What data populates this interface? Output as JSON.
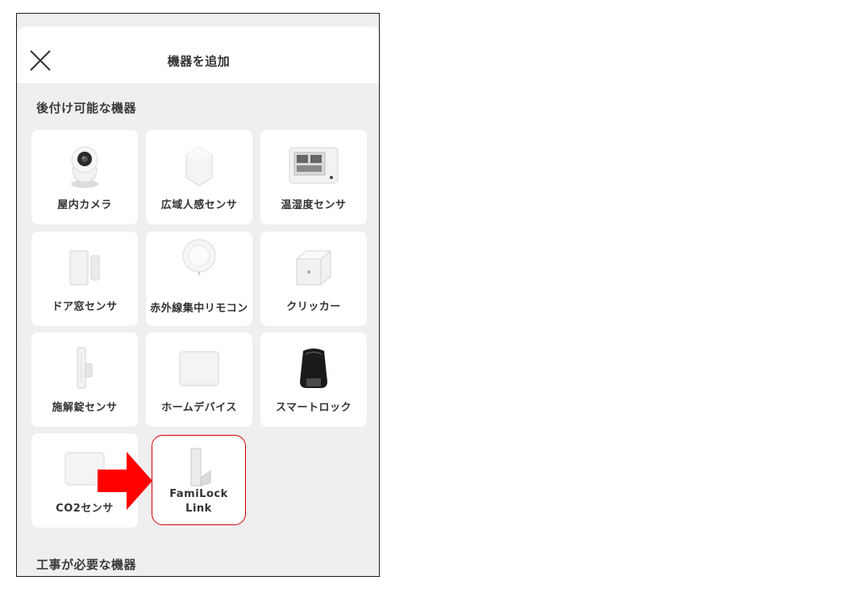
{
  "header": {
    "title": "機器を追加"
  },
  "sections": {
    "retrofit_title": "後付け可能な機器",
    "construction_title": "工事が必要な機器"
  },
  "devices": [
    {
      "label": "屋内カメラ",
      "icon": "camera-icon"
    },
    {
      "label": "広域人感センサ",
      "icon": "motion-sensor-icon"
    },
    {
      "label": "温湿度センサ",
      "icon": "thermo-hygrometer-icon"
    },
    {
      "label": "ドア窓センサ",
      "icon": "door-window-sensor-icon"
    },
    {
      "label": "赤外線集中リモコン",
      "icon": "ir-remote-icon"
    },
    {
      "label": "クリッカー",
      "icon": "clicker-icon"
    },
    {
      "label": "施解錠センサ",
      "icon": "lock-sensor-icon"
    },
    {
      "label": "ホームデバイス",
      "icon": "home-device-icon"
    },
    {
      "label": "スマートロック",
      "icon": "smart-lock-icon"
    },
    {
      "label": "CO2センサ",
      "icon": "co2-sensor-icon"
    },
    {
      "label": "FamiLock Link",
      "icon": "familock-link-icon"
    }
  ],
  "colors": {
    "highlight": "#d40000",
    "arrow": "#ff0000"
  }
}
